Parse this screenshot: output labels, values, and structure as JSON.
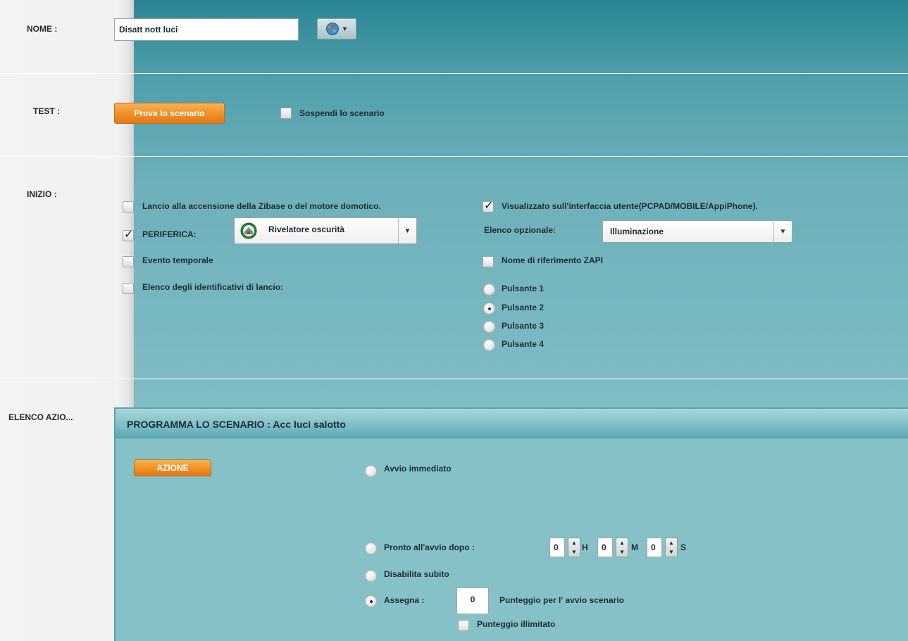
{
  "sections": {
    "name_label": "NOME :",
    "test_label": "TEST :",
    "start_label": "INIZIO :",
    "actions_label": "ELENCO AZIO..."
  },
  "name": {
    "value": "Disatt nott luci",
    "icon": "globe-icon"
  },
  "test": {
    "try_button": "Prova lo scenario",
    "suspend_label": "Sospendi lo scenario",
    "suspend_checked": false
  },
  "start": {
    "launch_on_power": {
      "label": "Lancio alla accensione della Zibase o del motore domotico.",
      "checked": false
    },
    "device": {
      "label": "PERIFERICA:",
      "checked": true,
      "selected": "Rivelatore oscurità",
      "icon": "sensor-icon"
    },
    "time_event": {
      "label": "Evento temporale",
      "checked": false
    },
    "launch_ids": {
      "label": "Elenco degli identificativi di lancio:",
      "checked": false
    },
    "show_ui": {
      "label": "Visualizzato sull'interfaccia utente(PCPAD/MOBILE/AppiPhone).",
      "checked": true
    },
    "optional_list": {
      "label": "Elenco opzionale:",
      "selected": "Illuminazione"
    },
    "zapi_name": {
      "label": "Nome di riferimento ZAPI",
      "checked": false
    },
    "buttons": [
      {
        "label": "Pulsante 1",
        "selected": false
      },
      {
        "label": "Pulsante 2",
        "selected": true
      },
      {
        "label": "Pulsante 3",
        "selected": false
      },
      {
        "label": "Pulsante 4",
        "selected": false
      }
    ]
  },
  "program": {
    "title": "PROGRAMMA LO SCENARIO : Acc luci salotto",
    "action_button": "AZIONE",
    "immediate": {
      "label": "Avvio immediato",
      "selected": false
    },
    "ready_after": {
      "label": "Pronto all'avvio dopo :",
      "selected": false,
      "hours": "0",
      "hours_unit": "H",
      "minutes": "0",
      "minutes_unit": "M",
      "seconds": "0",
      "seconds_unit": "S"
    },
    "disable_now": {
      "label": "Disabilita subito",
      "selected": false
    },
    "assign": {
      "label": "Assegna :",
      "selected": true,
      "value": "0",
      "suffix": "Punteggio per l' avvio scenario"
    },
    "unlimited_score": {
      "label": "Punteggio illimitato",
      "checked": false
    }
  },
  "colors": {
    "accent_orange": "#ef8f24",
    "teal_header": "#2a8694",
    "teal_body": "#86c1c8"
  }
}
